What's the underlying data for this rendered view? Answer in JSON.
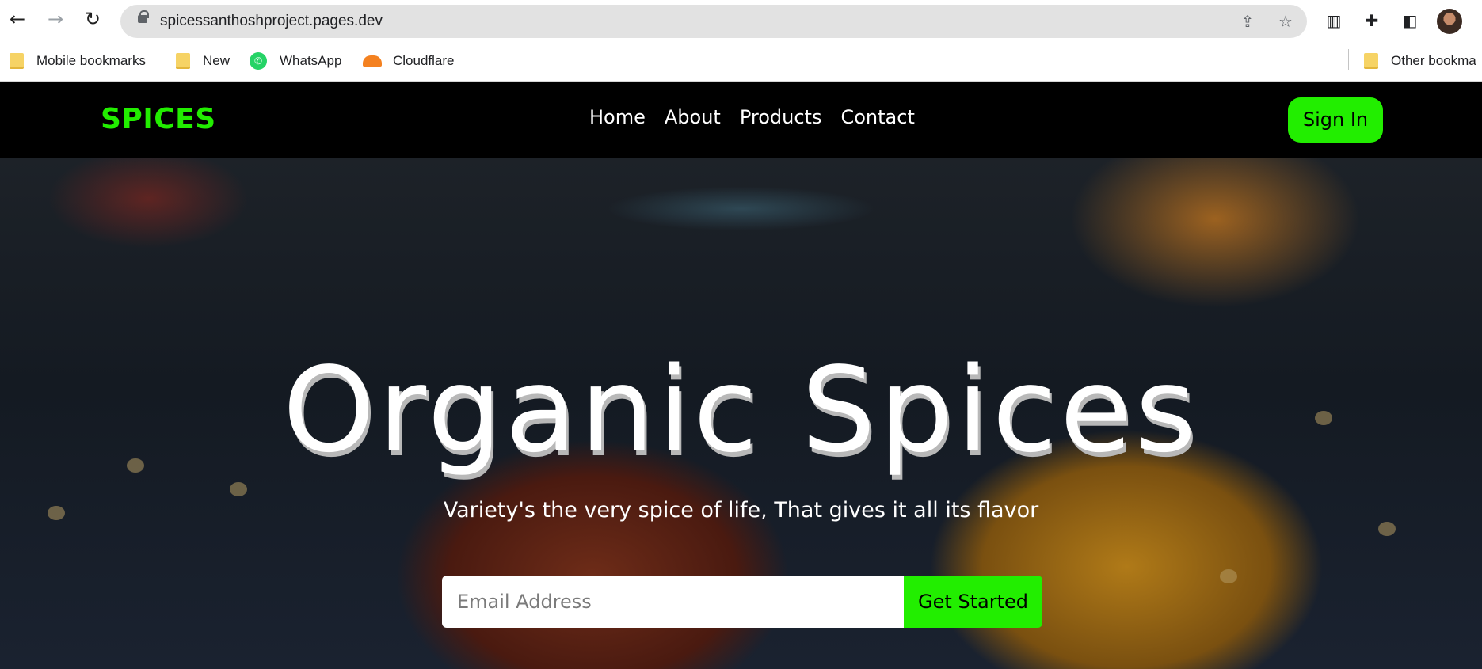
{
  "browser": {
    "url": "spicessanthoshproject.pages.dev",
    "bookmarks": [
      {
        "label": "Mobile bookmarks",
        "icon": "folder-icon"
      },
      {
        "label": "New",
        "icon": "folder-icon"
      },
      {
        "label": "WhatsApp",
        "icon": "whatsapp-icon"
      },
      {
        "label": "Cloudflare",
        "icon": "cloudflare-icon"
      }
    ],
    "other_bookmarks": "Other bookma"
  },
  "site": {
    "logo": "SPICES",
    "nav": [
      "Home",
      "About",
      "Products",
      "Contact"
    ],
    "signin_label": "Sign In",
    "hero": {
      "title": "Organic Spices",
      "subtitle": "Variety's the very spice of life, That gives it all its flavor",
      "email_placeholder": "Email Address",
      "cta_label": "Get Started"
    },
    "colors": {
      "accent": "#22ee00",
      "header_bg": "#000000"
    }
  }
}
